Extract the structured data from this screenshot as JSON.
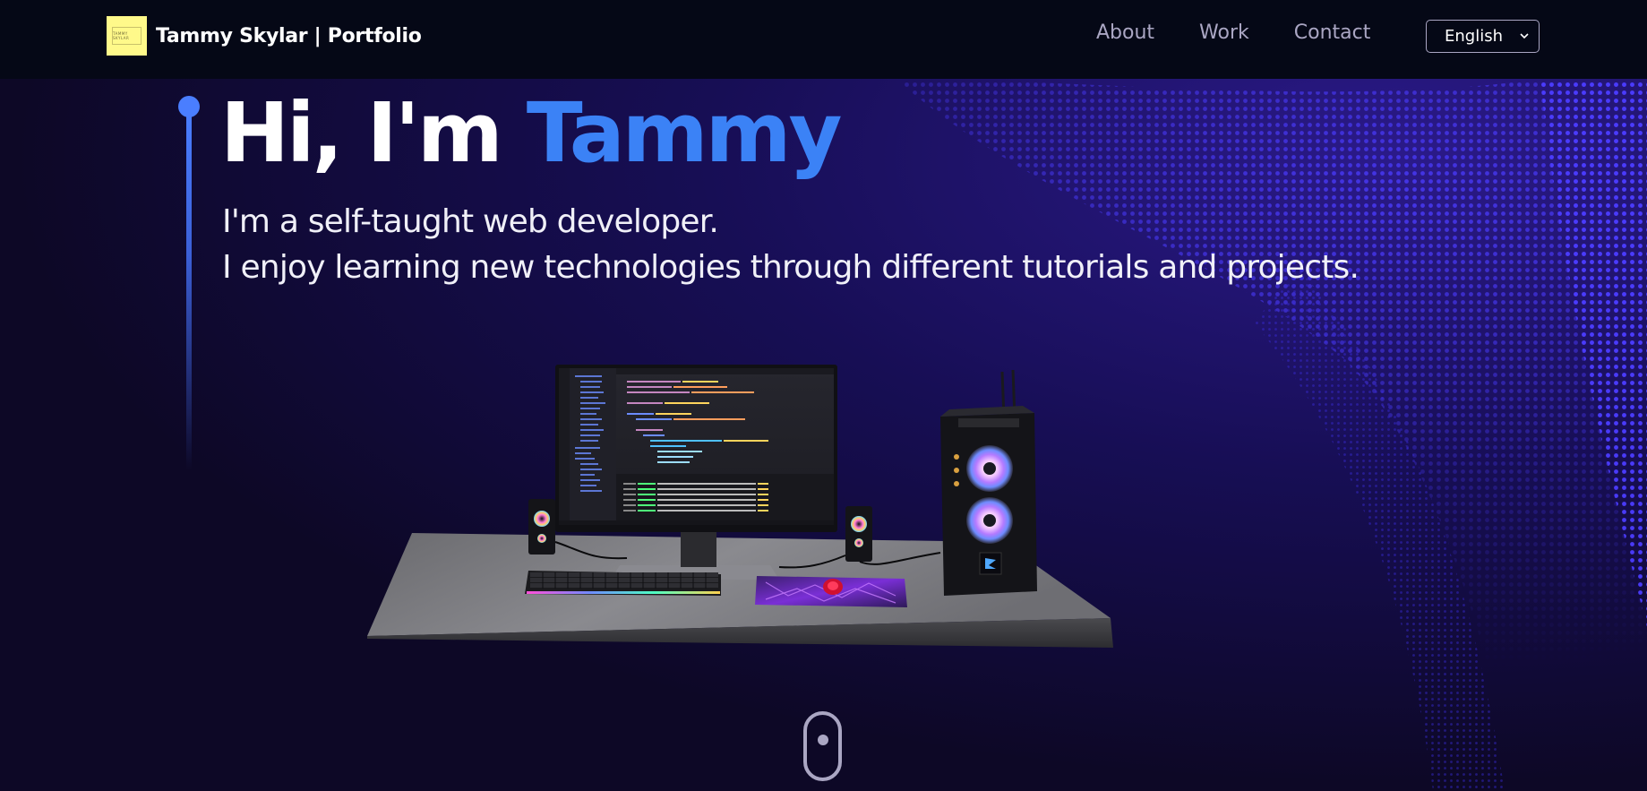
{
  "nav": {
    "brand_name": "Tammy Skylar",
    "brand_separator": " | ",
    "brand_suffix": "Portfolio",
    "logo_text": "TAMMY SKYLAR",
    "links": [
      {
        "label": "About"
      },
      {
        "label": "Work"
      },
      {
        "label": "Contact"
      }
    ],
    "language": {
      "selected": "English"
    }
  },
  "hero": {
    "greeting": "Hi, I'm ",
    "name": "Tammy",
    "line1": "I'm a self-taught web developer.",
    "line2": "I enjoy learning new technologies through different tutorials and projects."
  },
  "colors": {
    "accent": "#3b82f6",
    "nav_bg": "#050816",
    "nav_text": "#aaa6c3",
    "page_bg": "#0d0826",
    "logo_bg": "#fff98a"
  },
  "icons": {
    "select_chevron": "chevron-down-icon",
    "scroll": "mouse-scroll-icon"
  }
}
